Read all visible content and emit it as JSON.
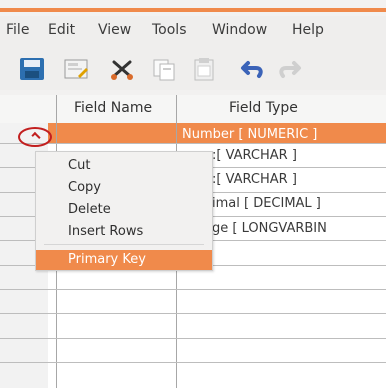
{
  "menu": [
    "File",
    "Edit",
    "View",
    "Tools",
    "Window",
    "Help"
  ],
  "toolbar": [
    "save",
    "edit",
    "cut",
    "copy",
    "paste",
    "undo",
    "redo"
  ],
  "table": {
    "headers": [
      "Field Name",
      "Field Type"
    ],
    "rows": [
      {
        "name": "",
        "type": "Number [ NUMERIC ]"
      },
      {
        "name": "",
        "type": ":[ VARCHAR ]"
      },
      {
        "name": "",
        "type": ":[ VARCHAR ]"
      },
      {
        "name": "",
        "type": "imal [ DECIMAL ]"
      },
      {
        "name": "",
        "type": "ge [ LONGVARBIN"
      }
    ]
  },
  "context_menu": {
    "items": [
      "Cut",
      "Copy",
      "Delete",
      "Insert Rows"
    ],
    "primary_key": "Primary Key"
  },
  "colors": {
    "accent": "#f08a4b",
    "annotation": "#c21f1f"
  }
}
